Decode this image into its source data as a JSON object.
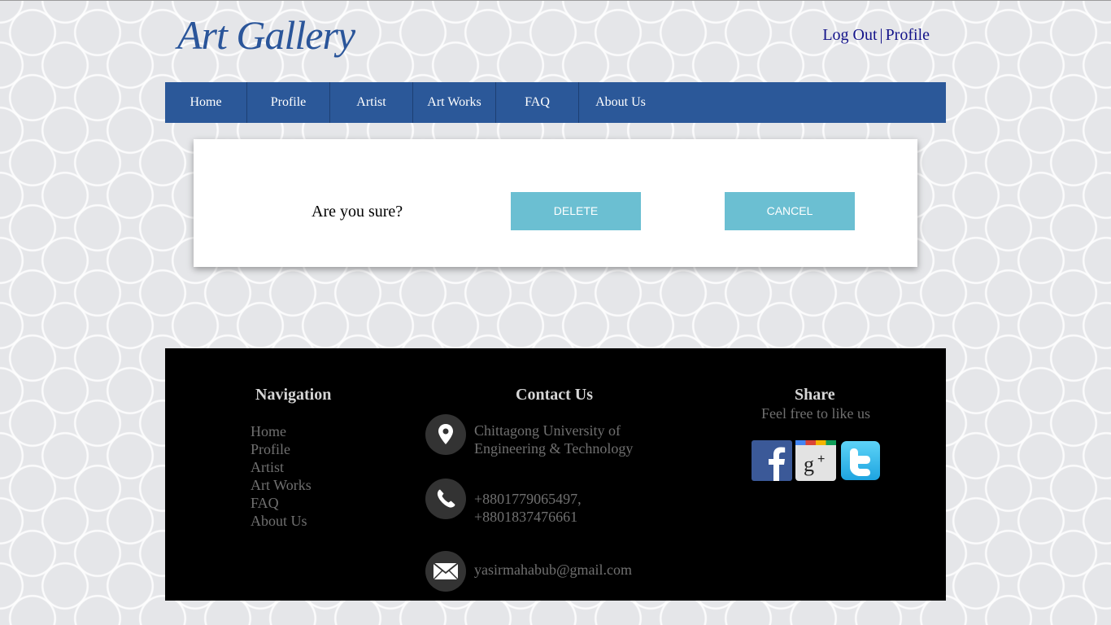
{
  "header": {
    "logo": "Art Gallery",
    "logout_label": "Log Out",
    "separator": "|",
    "profile_label": "Profile"
  },
  "nav": {
    "items": [
      {
        "label": "Home"
      },
      {
        "label": "Profile"
      },
      {
        "label": "Artist"
      },
      {
        "label": "Art Works"
      },
      {
        "label": "FAQ"
      },
      {
        "label": "About Us"
      }
    ]
  },
  "dialog": {
    "question": "Are you sure?",
    "delete_label": "DELETE",
    "cancel_label": "CANCEL"
  },
  "footer": {
    "navigation": {
      "title": "Navigation",
      "links": [
        "Home",
        "Profile",
        "Artist",
        "Art Works",
        "FAQ",
        "About Us"
      ]
    },
    "contact": {
      "title": "Contact Us",
      "address_line1": "Chittagong University of",
      "address_line2": "Engineering & Technology",
      "phone_line1": "+8801779065497,",
      "phone_line2": "+8801837476661",
      "email": "yasirmahabub@gmail.com",
      "icons": [
        "map-pin-icon",
        "phone-icon",
        "envelope-icon"
      ]
    },
    "share": {
      "title": "Share",
      "subtitle": "Feel free to like us",
      "icons": [
        "facebook-icon",
        "google-plus-icon",
        "twitter-icon"
      ]
    }
  },
  "colors": {
    "brand_blue": "#2b5899",
    "button_teal": "#6bbfd2",
    "footer_bg": "#000000",
    "link_navy": "#14148a"
  }
}
